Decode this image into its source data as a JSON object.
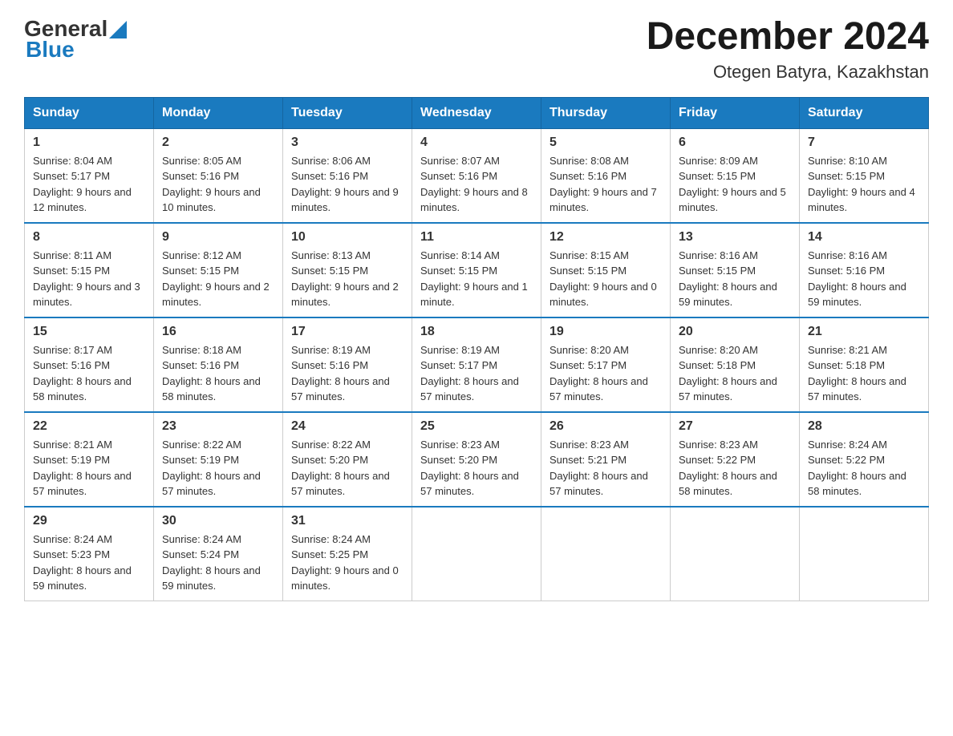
{
  "header": {
    "logo_text_black": "General",
    "logo_text_blue": "Blue",
    "month_title": "December 2024",
    "location": "Otegen Batyra, Kazakhstan"
  },
  "weekdays": [
    "Sunday",
    "Monday",
    "Tuesday",
    "Wednesday",
    "Thursday",
    "Friday",
    "Saturday"
  ],
  "weeks": [
    [
      {
        "day": "1",
        "sunrise": "Sunrise: 8:04 AM",
        "sunset": "Sunset: 5:17 PM",
        "daylight": "Daylight: 9 hours and 12 minutes."
      },
      {
        "day": "2",
        "sunrise": "Sunrise: 8:05 AM",
        "sunset": "Sunset: 5:16 PM",
        "daylight": "Daylight: 9 hours and 10 minutes."
      },
      {
        "day": "3",
        "sunrise": "Sunrise: 8:06 AM",
        "sunset": "Sunset: 5:16 PM",
        "daylight": "Daylight: 9 hours and 9 minutes."
      },
      {
        "day": "4",
        "sunrise": "Sunrise: 8:07 AM",
        "sunset": "Sunset: 5:16 PM",
        "daylight": "Daylight: 9 hours and 8 minutes."
      },
      {
        "day": "5",
        "sunrise": "Sunrise: 8:08 AM",
        "sunset": "Sunset: 5:16 PM",
        "daylight": "Daylight: 9 hours and 7 minutes."
      },
      {
        "day": "6",
        "sunrise": "Sunrise: 8:09 AM",
        "sunset": "Sunset: 5:15 PM",
        "daylight": "Daylight: 9 hours and 5 minutes."
      },
      {
        "day": "7",
        "sunrise": "Sunrise: 8:10 AM",
        "sunset": "Sunset: 5:15 PM",
        "daylight": "Daylight: 9 hours and 4 minutes."
      }
    ],
    [
      {
        "day": "8",
        "sunrise": "Sunrise: 8:11 AM",
        "sunset": "Sunset: 5:15 PM",
        "daylight": "Daylight: 9 hours and 3 minutes."
      },
      {
        "day": "9",
        "sunrise": "Sunrise: 8:12 AM",
        "sunset": "Sunset: 5:15 PM",
        "daylight": "Daylight: 9 hours and 2 minutes."
      },
      {
        "day": "10",
        "sunrise": "Sunrise: 8:13 AM",
        "sunset": "Sunset: 5:15 PM",
        "daylight": "Daylight: 9 hours and 2 minutes."
      },
      {
        "day": "11",
        "sunrise": "Sunrise: 8:14 AM",
        "sunset": "Sunset: 5:15 PM",
        "daylight": "Daylight: 9 hours and 1 minute."
      },
      {
        "day": "12",
        "sunrise": "Sunrise: 8:15 AM",
        "sunset": "Sunset: 5:15 PM",
        "daylight": "Daylight: 9 hours and 0 minutes."
      },
      {
        "day": "13",
        "sunrise": "Sunrise: 8:16 AM",
        "sunset": "Sunset: 5:15 PM",
        "daylight": "Daylight: 8 hours and 59 minutes."
      },
      {
        "day": "14",
        "sunrise": "Sunrise: 8:16 AM",
        "sunset": "Sunset: 5:16 PM",
        "daylight": "Daylight: 8 hours and 59 minutes."
      }
    ],
    [
      {
        "day": "15",
        "sunrise": "Sunrise: 8:17 AM",
        "sunset": "Sunset: 5:16 PM",
        "daylight": "Daylight: 8 hours and 58 minutes."
      },
      {
        "day": "16",
        "sunrise": "Sunrise: 8:18 AM",
        "sunset": "Sunset: 5:16 PM",
        "daylight": "Daylight: 8 hours and 58 minutes."
      },
      {
        "day": "17",
        "sunrise": "Sunrise: 8:19 AM",
        "sunset": "Sunset: 5:16 PM",
        "daylight": "Daylight: 8 hours and 57 minutes."
      },
      {
        "day": "18",
        "sunrise": "Sunrise: 8:19 AM",
        "sunset": "Sunset: 5:17 PM",
        "daylight": "Daylight: 8 hours and 57 minutes."
      },
      {
        "day": "19",
        "sunrise": "Sunrise: 8:20 AM",
        "sunset": "Sunset: 5:17 PM",
        "daylight": "Daylight: 8 hours and 57 minutes."
      },
      {
        "day": "20",
        "sunrise": "Sunrise: 8:20 AM",
        "sunset": "Sunset: 5:18 PM",
        "daylight": "Daylight: 8 hours and 57 minutes."
      },
      {
        "day": "21",
        "sunrise": "Sunrise: 8:21 AM",
        "sunset": "Sunset: 5:18 PM",
        "daylight": "Daylight: 8 hours and 57 minutes."
      }
    ],
    [
      {
        "day": "22",
        "sunrise": "Sunrise: 8:21 AM",
        "sunset": "Sunset: 5:19 PM",
        "daylight": "Daylight: 8 hours and 57 minutes."
      },
      {
        "day": "23",
        "sunrise": "Sunrise: 8:22 AM",
        "sunset": "Sunset: 5:19 PM",
        "daylight": "Daylight: 8 hours and 57 minutes."
      },
      {
        "day": "24",
        "sunrise": "Sunrise: 8:22 AM",
        "sunset": "Sunset: 5:20 PM",
        "daylight": "Daylight: 8 hours and 57 minutes."
      },
      {
        "day": "25",
        "sunrise": "Sunrise: 8:23 AM",
        "sunset": "Sunset: 5:20 PM",
        "daylight": "Daylight: 8 hours and 57 minutes."
      },
      {
        "day": "26",
        "sunrise": "Sunrise: 8:23 AM",
        "sunset": "Sunset: 5:21 PM",
        "daylight": "Daylight: 8 hours and 57 minutes."
      },
      {
        "day": "27",
        "sunrise": "Sunrise: 8:23 AM",
        "sunset": "Sunset: 5:22 PM",
        "daylight": "Daylight: 8 hours and 58 minutes."
      },
      {
        "day": "28",
        "sunrise": "Sunrise: 8:24 AM",
        "sunset": "Sunset: 5:22 PM",
        "daylight": "Daylight: 8 hours and 58 minutes."
      }
    ],
    [
      {
        "day": "29",
        "sunrise": "Sunrise: 8:24 AM",
        "sunset": "Sunset: 5:23 PM",
        "daylight": "Daylight: 8 hours and 59 minutes."
      },
      {
        "day": "30",
        "sunrise": "Sunrise: 8:24 AM",
        "sunset": "Sunset: 5:24 PM",
        "daylight": "Daylight: 8 hours and 59 minutes."
      },
      {
        "day": "31",
        "sunrise": "Sunrise: 8:24 AM",
        "sunset": "Sunset: 5:25 PM",
        "daylight": "Daylight: 9 hours and 0 minutes."
      },
      {
        "day": "",
        "sunrise": "",
        "sunset": "",
        "daylight": ""
      },
      {
        "day": "",
        "sunrise": "",
        "sunset": "",
        "daylight": ""
      },
      {
        "day": "",
        "sunrise": "",
        "sunset": "",
        "daylight": ""
      },
      {
        "day": "",
        "sunrise": "",
        "sunset": "",
        "daylight": ""
      }
    ]
  ]
}
